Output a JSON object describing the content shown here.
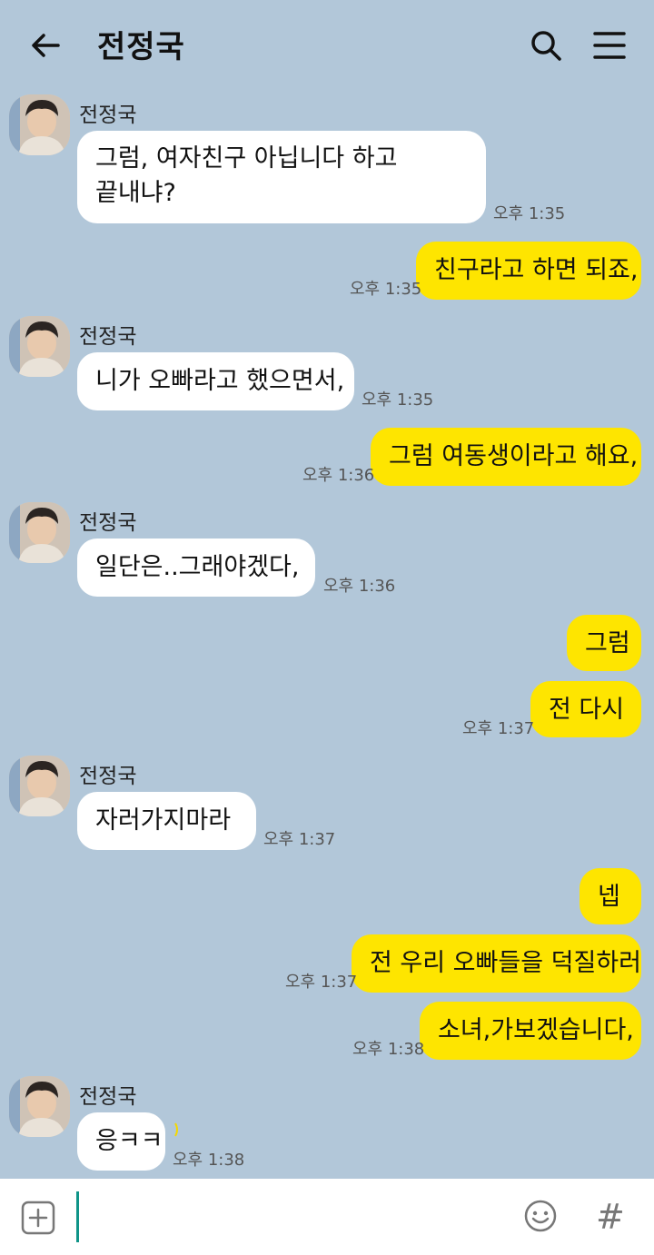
{
  "header": {
    "title": "전정국",
    "icons": [
      "back-arrow-icon",
      "search-icon",
      "menu-icon"
    ]
  },
  "contact": {
    "name": "전정국"
  },
  "messages": [
    {
      "side": "left",
      "text": "그럼, 여자친구 아닙니다 하고\n끝내냐?",
      "time": "오후 1:35"
    },
    {
      "side": "right",
      "text": "친구라고 하면 되죠,",
      "time": "오후 1:35"
    },
    {
      "side": "left",
      "text": "니가 오빠라고 했으면서,",
      "time": "오후 1:35"
    },
    {
      "side": "right",
      "text": "그럼 여동생이라고 해요,",
      "time": "오후 1:36"
    },
    {
      "side": "left",
      "text": "일단은..그래야겠다,",
      "time": "오후 1:36"
    },
    {
      "side": "right",
      "text": "그럼",
      "time": ""
    },
    {
      "side": "right",
      "text": "전 다시",
      "time": "오후 1:37"
    },
    {
      "side": "left",
      "text": "자러가지마라",
      "time": "오후 1:37"
    },
    {
      "side": "right",
      "text": "넵",
      "time": ""
    },
    {
      "side": "right",
      "text": "전 우리 오빠들을 덕질하러",
      "time": "오후 1:37"
    },
    {
      "side": "right",
      "text": "소녀,가보겠습니다,",
      "time": "오후 1:38"
    },
    {
      "side": "left",
      "text": "응ㅋㅋ",
      "time": "오후 1:38"
    }
  ],
  "input": {
    "placeholder": "",
    "icons": [
      "add-icon",
      "emoji-icon",
      "hashtag-icon"
    ],
    "hash_glyph": "#"
  },
  "colors": {
    "background": "#b2c7d9",
    "my_bubble": "#fee500",
    "their_bubble": "#ffffff",
    "cursor": "#0f9488"
  }
}
